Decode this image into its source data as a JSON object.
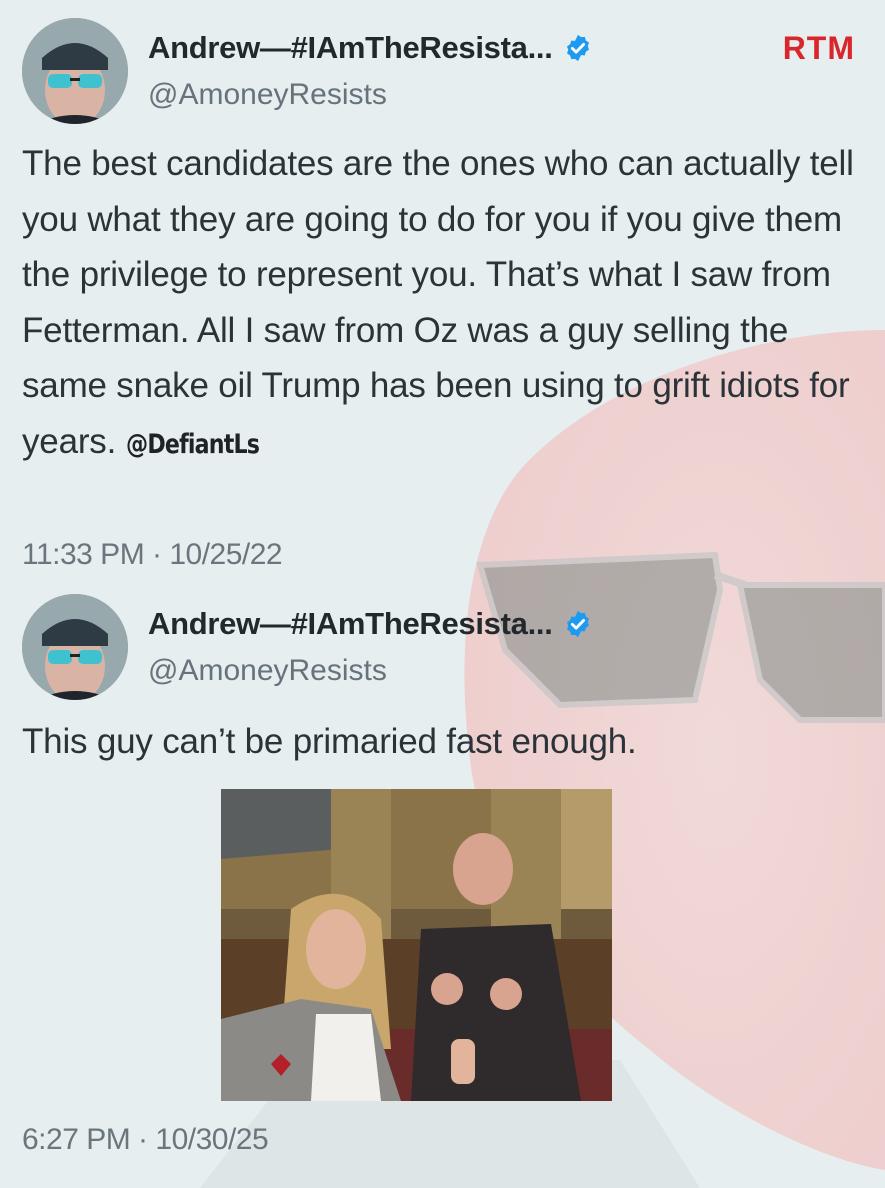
{
  "logo": {
    "text": "RTM",
    "color": "#d8262b"
  },
  "tweets": [
    {
      "display_name": "Andrew—#IAmTheResista...",
      "handle": "@AmoneyResists",
      "text": "The best candidates are the ones who can actually tell you what they are going to do for you if you give them the privilege to represent you. That’s what I saw from Fetterman. All I saw from Oz was a guy selling the same snake oil  Trump has been using to grift idiots for years.",
      "mention": "@DefiantLs",
      "timestamp": "11:33 PM · 10/25/22",
      "verified_icon": "verified-badge-icon"
    },
    {
      "display_name": "Andrew—#IAmTheResista...",
      "handle": "@AmoneyResists",
      "text": "This guy can’t be primaried fast enough.",
      "timestamp": "6:27 PM · 10/30/25",
      "verified_icon": "verified-badge-icon"
    }
  ],
  "colors": {
    "background": "#e6eeef",
    "verified_blue": "#1d9bf0",
    "handle_gray": "#66737b"
  }
}
